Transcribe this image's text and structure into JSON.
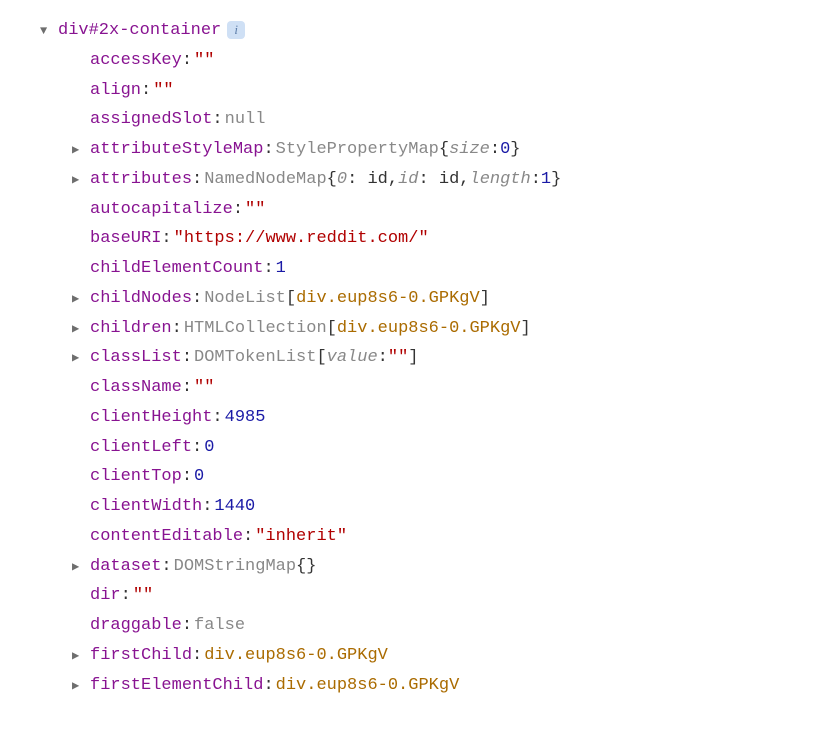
{
  "header": {
    "elementLabel": "div#2x-container",
    "infoBadge": "i"
  },
  "props": [
    {
      "k": "accessKey",
      "type": "string",
      "v": "\"\""
    },
    {
      "k": "align",
      "type": "string",
      "v": "\"\""
    },
    {
      "k": "assignedSlot",
      "type": "null",
      "v": "null"
    },
    {
      "k": "attributeStyleMap",
      "type": "obj",
      "exp": true,
      "otype": "StylePropertyMap",
      "parts": [
        {
          "kind": "ikey",
          "t": "size"
        },
        {
          "kind": "colon",
          "t": ": "
        },
        {
          "kind": "num",
          "t": "0"
        }
      ]
    },
    {
      "k": "attributes",
      "type": "obj",
      "exp": true,
      "otype": "NamedNodeMap",
      "parts": [
        {
          "kind": "ikey",
          "t": "0"
        },
        {
          "kind": "colon",
          "t": ": "
        },
        {
          "kind": "plain",
          "t": "id"
        },
        {
          "kind": "sep",
          "t": ", "
        },
        {
          "kind": "ikey",
          "t": "id"
        },
        {
          "kind": "colon",
          "t": ": "
        },
        {
          "kind": "plain",
          "t": "id"
        },
        {
          "kind": "sep",
          "t": ", "
        },
        {
          "kind": "ikey",
          "t": "length"
        },
        {
          "kind": "colon",
          "t": ": "
        },
        {
          "kind": "num",
          "t": "1"
        }
      ]
    },
    {
      "k": "autocapitalize",
      "type": "string",
      "v": "\"\""
    },
    {
      "k": "baseURI",
      "type": "string",
      "v": "\"https://www.reddit.com/\""
    },
    {
      "k": "childElementCount",
      "type": "number",
      "v": "1"
    },
    {
      "k": "childNodes",
      "type": "list",
      "exp": true,
      "otype": "NodeList",
      "items": [
        {
          "kind": "ref",
          "t": "div.eup8s6-0.GPKgV"
        }
      ]
    },
    {
      "k": "children",
      "type": "list",
      "exp": true,
      "otype": "HTMLCollection",
      "items": [
        {
          "kind": "ref",
          "t": "div.eup8s6-0.GPKgV"
        }
      ]
    },
    {
      "k": "classList",
      "type": "list",
      "exp": true,
      "otype": "DOMTokenList",
      "items": [
        {
          "kind": "ikey",
          "t": "value"
        },
        {
          "kind": "colon",
          "t": ": "
        },
        {
          "kind": "str",
          "t": "\"\""
        }
      ]
    },
    {
      "k": "className",
      "type": "string",
      "v": "\"\""
    },
    {
      "k": "clientHeight",
      "type": "number",
      "v": "4985"
    },
    {
      "k": "clientLeft",
      "type": "number",
      "v": "0"
    },
    {
      "k": "clientTop",
      "type": "number",
      "v": "0"
    },
    {
      "k": "clientWidth",
      "type": "number",
      "v": "1440"
    },
    {
      "k": "contentEditable",
      "type": "string",
      "v": "\"inherit\""
    },
    {
      "k": "dataset",
      "type": "obj",
      "exp": true,
      "otype": "DOMStringMap",
      "parts": []
    },
    {
      "k": "dir",
      "type": "string",
      "v": "\"\""
    },
    {
      "k": "draggable",
      "type": "bool",
      "v": "false"
    },
    {
      "k": "firstChild",
      "type": "ref",
      "exp": true,
      "v": "div.eup8s6-0.GPKgV"
    },
    {
      "k": "firstElementChild",
      "type": "ref",
      "exp": true,
      "v": "div.eup8s6-0.GPKgV"
    }
  ]
}
